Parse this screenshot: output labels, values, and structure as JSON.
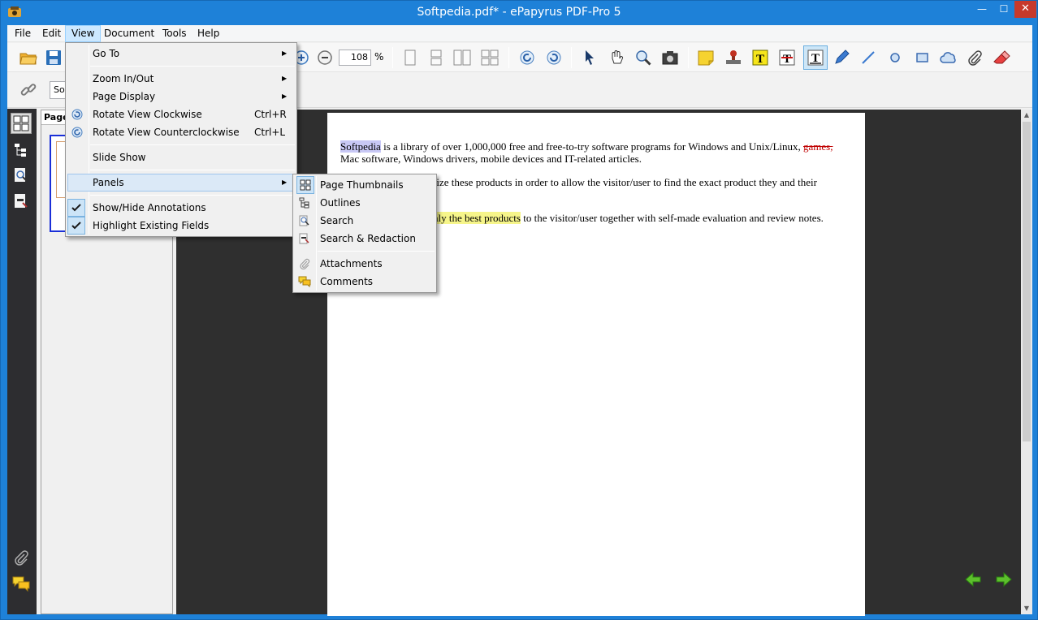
{
  "window": {
    "title": "Softpedia.pdf* - ePapyrus PDF-Pro 5",
    "min": "—",
    "max": "☐",
    "close": "✕"
  },
  "menubar": [
    "File",
    "Edit",
    "View",
    "Document",
    "Tools",
    "Help"
  ],
  "toolbar": {
    "zoom_value": "108",
    "zoom_unit": "%",
    "font_box": "So"
  },
  "panel": {
    "tab_label": "Page"
  },
  "view_menu": {
    "items": [
      {
        "label": "Go To",
        "submenu": true
      },
      {
        "label": "Zoom In/Out",
        "submenu": true
      },
      {
        "label": "Page Display",
        "submenu": true
      },
      {
        "label": "Rotate View Clockwise",
        "shortcut": "Ctrl+R"
      },
      {
        "label": "Rotate View Counterclockwise",
        "shortcut": "Ctrl+L"
      },
      {
        "label": "Slide Show"
      },
      {
        "label": "Panels",
        "submenu": true
      },
      {
        "label": "Show/Hide Annotations",
        "checked": true
      },
      {
        "label": "Highlight Existing Fields",
        "checked": true
      }
    ]
  },
  "panels_submenu": {
    "items": [
      {
        "label": "Page Thumbnails",
        "icon": "thumbnails-icon"
      },
      {
        "label": "Outlines",
        "icon": "outlines-icon"
      },
      {
        "label": "Search",
        "icon": "search-icon"
      },
      {
        "label": "Search & Redaction",
        "icon": "redaction-icon"
      },
      {
        "label": "Attachments",
        "icon": "paperclip-icon"
      },
      {
        "label": "Comments",
        "icon": "comments-icon"
      }
    ]
  },
  "document": {
    "p1_highlight": "Softpedia",
    "p1_rest": " is a library of over 1,000,000 free and free-to-try software programs for Windows and Unix/Linux, ",
    "p1_strike": "games,",
    "p1_line2": "Mac software, Windows drivers, mobile devices and IT-related articles.",
    "p2_visible": "rize these products in order to allow the visitor/user to find the exact product they and their",
    "p3_highlight": "nly the best products",
    "p3_rest": " to the visitor/user together with self-made evaluation and review notes."
  },
  "colors": {
    "accent": "#1e81d8",
    "menu_hover": "#dbe9f7",
    "highlight_yellow": "#f6f58a",
    "highlight_blue": "#c8c8f5"
  }
}
